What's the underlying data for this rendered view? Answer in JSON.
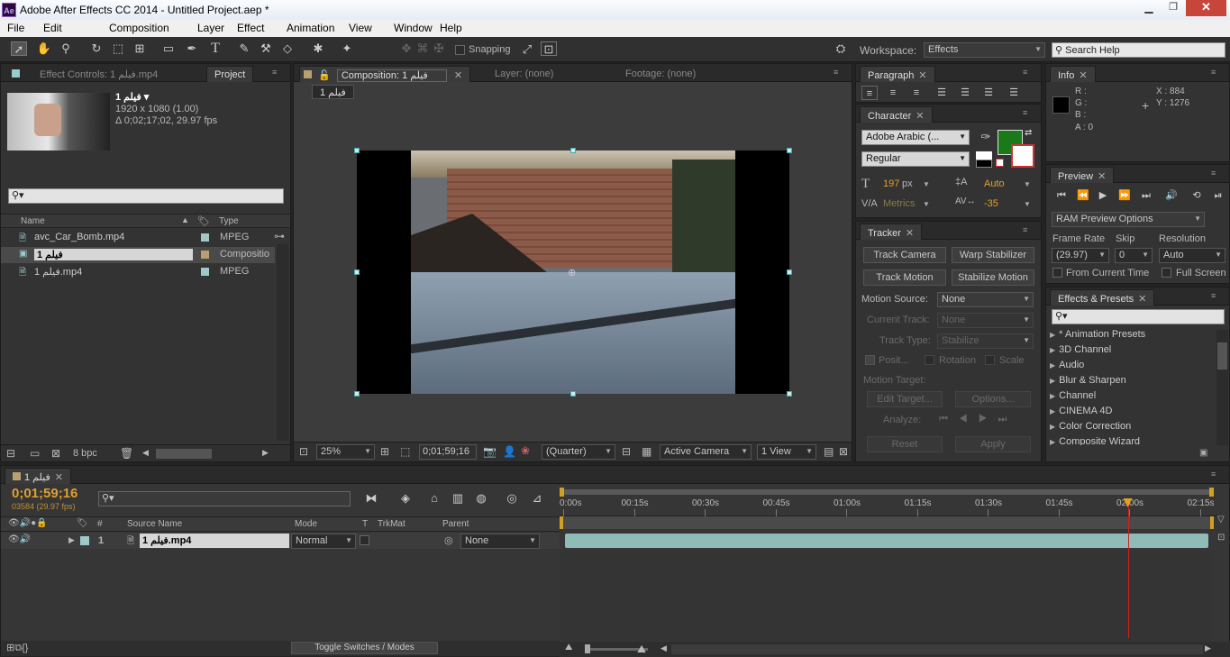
{
  "title_bar": {
    "title": "Adobe After Effects CC 2014 - Untitled Project.aep *",
    "app_icon": "Ae"
  },
  "menu": [
    "File",
    "Edit",
    "Composition",
    "Layer",
    "Effect",
    "Animation",
    "View",
    "Window",
    "Help"
  ],
  "toolbar": {
    "snapping": "Snapping",
    "workspace_label": "Workspace:",
    "workspace_value": "Effects",
    "search_placeholder": "Search Help"
  },
  "project_panel": {
    "tab_effect_controls": "Effect Controls: فیلم 1.mp4",
    "tab_project": "Project",
    "item_name": "فیلم 1 ▾",
    "item_info1": "1920 x 1080 (1.00)",
    "item_info2": "Δ 0;02;17;02, 29.97 fps",
    "col_name": "Name",
    "col_type": "Type",
    "rows": [
      {
        "name": "avc_Car_Bomb.mp4",
        "type": "MPEG",
        "color": "#9fc8c8"
      },
      {
        "name": "فیلم 1",
        "type": "Compositio",
        "color": "#b8a070"
      },
      {
        "name": "فیلم 1.mp4",
        "type": "MPEG",
        "color": "#9fc8c8"
      }
    ],
    "bpc": "8 bpc"
  },
  "composition_panel": {
    "tab_comp": "Composition: فیلم 1",
    "tab_layer": "Layer: (none)",
    "tab_footage": "Footage: (none)",
    "comp_chip": "فیلم 1",
    "zoom": "25%",
    "timecode": "0;01;59;16",
    "quality": "(Quarter)",
    "camera": "Active Camera",
    "views": "1 View"
  },
  "paragraph_panel": {
    "tab": "Paragraph"
  },
  "character_panel": {
    "tab": "Character",
    "font": "Adobe Arabic (...",
    "style": "Regular",
    "size": "197",
    "size_unit": "px",
    "leading": "Auto",
    "kerning": "Metrics",
    "tracking": "-35",
    "fill_color": "#1a7a1a"
  },
  "tracker_panel": {
    "tab": "Tracker",
    "track_camera": "Track Camera",
    "warp_stabilizer": "Warp Stabilizer",
    "track_motion": "Track Motion",
    "stabilize_motion": "Stabilize Motion",
    "motion_source_label": "Motion Source:",
    "motion_source": "None",
    "current_track_label": "Current Track:",
    "current_track": "None",
    "track_type_label": "Track Type:",
    "track_type": "Stabilize",
    "position": "Posit...",
    "rotation": "Rotation",
    "scale": "Scale",
    "motion_target": "Motion Target:",
    "edit_target": "Edit Target...",
    "options": "Options...",
    "analyze": "Analyze:",
    "reset": "Reset",
    "apply": "Apply"
  },
  "info_panel": {
    "tab": "Info",
    "r": "R :",
    "g": "G :",
    "b": "B :",
    "a": "A : 0",
    "x": "X : 884",
    "y": "Y : 1276"
  },
  "preview_panel": {
    "tab": "Preview",
    "ram_options": "RAM Preview Options",
    "frame_rate_label": "Frame Rate",
    "skip_label": "Skip",
    "resolution_label": "Resolution",
    "frame_rate": "(29.97)",
    "skip": "0",
    "resolution": "Auto",
    "from_current_time": "From Current Time",
    "full_screen": "Full Screen"
  },
  "effects_panel": {
    "tab": "Effects & Presets",
    "items": [
      "* Animation Presets",
      "3D Channel",
      "Audio",
      "Blur & Sharpen",
      "Channel",
      "CINEMA 4D",
      "Color Correction",
      "Composite Wizard"
    ]
  },
  "timeline": {
    "tab": "فیلم 1",
    "timecode": "0;01;59;16",
    "frames": "03584 (29.97 fps)",
    "col_source": "Source Name",
    "col_mode": "Mode",
    "col_t": "T",
    "col_trkmat": "TrkMat",
    "col_parent": "Parent",
    "ruler": [
      "0:00s",
      "00:15s",
      "00:30s",
      "00:45s",
      "01:00s",
      "01:15s",
      "01:30s",
      "01:45s",
      "02:00s",
      "02:15s"
    ],
    "layer": {
      "num": "1",
      "name": "فیلم 1.mp4",
      "mode": "Normal",
      "parent": "None"
    },
    "toggle": "Toggle Switches / Modes",
    "playhead_fraction": 0.88
  }
}
